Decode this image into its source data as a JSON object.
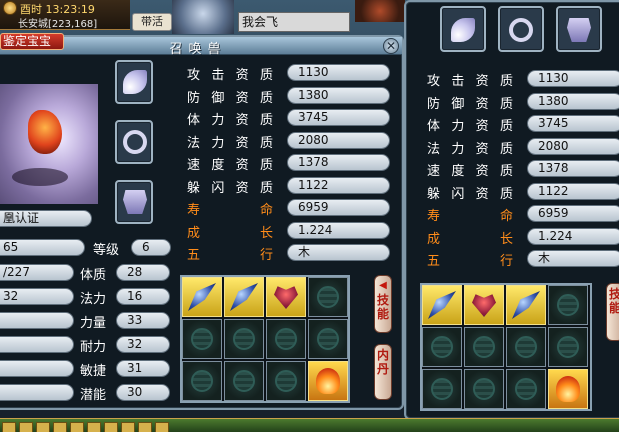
{
  "hud": {
    "time": "酉时 13:23:19",
    "location": "长安城[223,168]",
    "tab_label": "带活",
    "chat_text": "我会飞"
  },
  "left_panel": {
    "title": "召唤兽",
    "appraise_tab": "鉴定宝宝",
    "cert_label": "凰认证",
    "row1_value": "65",
    "level_label": "等级",
    "level_value": "6",
    "attributes": [
      {
        "value_left": "/227",
        "label": "体质",
        "value": "28"
      },
      {
        "value_left": "32",
        "label": "法力",
        "value": "16"
      },
      {
        "value_left": "",
        "label": "力量",
        "value": "33"
      },
      {
        "value_left": "",
        "label": "耐力",
        "value": "32"
      },
      {
        "value_left": "",
        "label": "敏捷",
        "value": "31"
      },
      {
        "value_left": "",
        "label": "潜能",
        "value": "30"
      }
    ],
    "aptitudes": [
      {
        "label": "攻击资质",
        "value": "1130"
      },
      {
        "label": "防御资质",
        "value": "1380"
      },
      {
        "label": "体力资质",
        "value": "3745"
      },
      {
        "label": "法力资质",
        "value": "2080"
      },
      {
        "label": "速度资质",
        "value": "1378"
      },
      {
        "label": "躲闪资质",
        "value": "1122"
      }
    ],
    "extra": [
      {
        "label": "寿命",
        "value": "6959"
      },
      {
        "label": "成长",
        "value": "1.224"
      },
      {
        "label": "五行",
        "value": "木"
      }
    ],
    "side_tabs": {
      "skill": "技能",
      "inner": "内丹"
    },
    "equip_icons": [
      "fan-icon",
      "ring-icon",
      "armor-icon"
    ]
  },
  "right_panel": {
    "aptitudes": [
      {
        "label": "攻击资质",
        "value": "1130"
      },
      {
        "label": "防御资质",
        "value": "1380"
      },
      {
        "label": "体力资质",
        "value": "3745"
      },
      {
        "label": "法力资质",
        "value": "2080"
      },
      {
        "label": "速度资质",
        "value": "1378"
      },
      {
        "label": "躲闪资质",
        "value": "1122"
      }
    ],
    "extra": [
      {
        "label": "寿命",
        "value": "6959"
      },
      {
        "label": "成长",
        "value": "1.224"
      },
      {
        "label": "五行",
        "value": "木"
      }
    ],
    "side_tab": "技能"
  },
  "colors": {
    "label_white": "#ffffff",
    "label_orange": "#ff8c1a",
    "panel_border": "#7f97a8"
  }
}
